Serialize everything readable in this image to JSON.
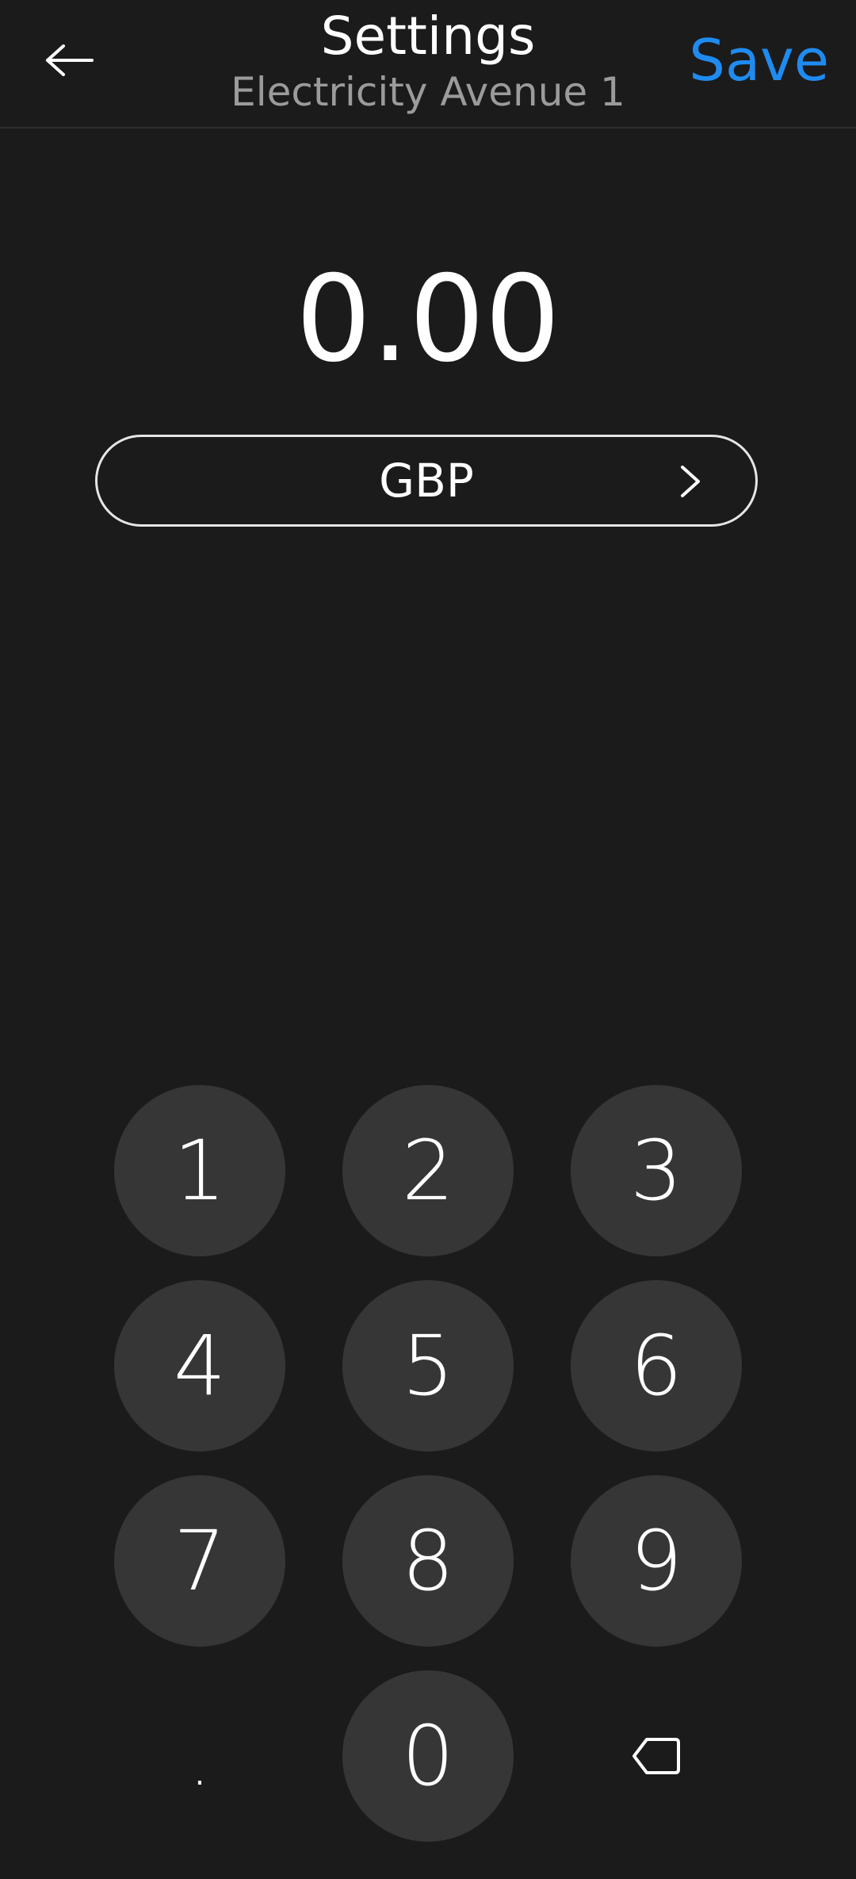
{
  "header": {
    "title": "Settings",
    "subtitle": "Electricity Avenue 1",
    "back_icon": "back-arrow-icon",
    "save_label": "Save"
  },
  "amount": {
    "value": "0.00"
  },
  "currency": {
    "label": "GBP",
    "chevron_icon": "chevron-right-icon"
  },
  "keypad": {
    "keys": [
      "1",
      "2",
      "3",
      "4",
      "5",
      "6",
      "7",
      "8",
      "9",
      ".",
      "0"
    ],
    "backspace_icon": "backspace-icon"
  },
  "colors": {
    "background": "#1b1b1b",
    "key": "#363636",
    "accent": "#1f8bf0",
    "subtitle": "#9b9b9b"
  }
}
